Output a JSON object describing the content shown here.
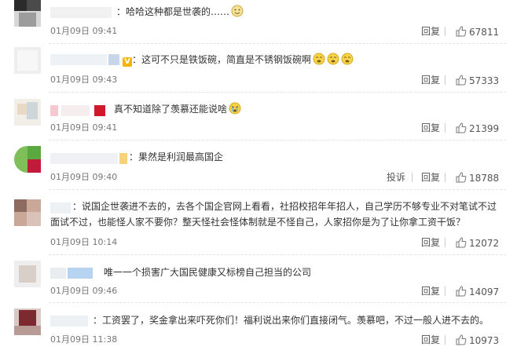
{
  "comments": [
    {
      "text": "：哈哈这种都是世袭的……",
      "time": "01月09日 09:41",
      "reply": "回复",
      "likes": "67811"
    },
    {
      "text": "：这可不只是铁饭碗，简直是不锈钢饭碗啊",
      "time": "01月09日 09:43",
      "reply": "回复",
      "likes": "57333"
    },
    {
      "text": "真不知道除了羡慕还能说啥",
      "time": "01月09日 09:41",
      "reply": "回复",
      "likes": "21399"
    },
    {
      "text": "：果然是利润最高国企",
      "time": "01月09日 09:40",
      "report": "投诉",
      "reply": "回复",
      "likes": "18788"
    },
    {
      "line1": "：说国企世袭进不去的，去各个国企官网上看看，社招校招年年招人，自己学历不够专业不对笔试不过",
      "line2": "面试不过，也能怪人家不要你？整天怪社会怪体制就是不怪自己，人家招你是为了让你拿工资干饭？",
      "time": "01月09日 10:14",
      "reply": "回复",
      "likes": "12072"
    },
    {
      "text": "唯一一个损害广大国民健康又标榜自己担当的公司",
      "time": "01月09日 09:46",
      "reply": "回复",
      "likes": "14097"
    },
    {
      "text": "：工资罢了，奖金拿出来吓死你们！福利说出来你们直接闭气。羡慕吧，不过一般人进不去的。",
      "time": "01月09日 11:38",
      "reply": "回复",
      "likes": "10973"
    }
  ],
  "colors": {
    "text": "#333333",
    "meta": "#777777",
    "divider": "#e3e3e3",
    "emoji": "#f7d34a"
  },
  "icons": {
    "like": "thumbs-up-icon",
    "emoji": "face-emoji-icon",
    "badge": "verified-v-icon"
  }
}
